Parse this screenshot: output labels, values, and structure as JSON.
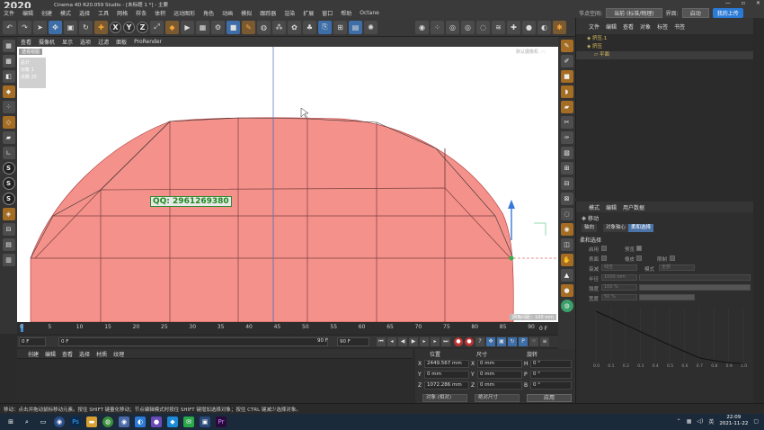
{
  "window": {
    "title": "Cinema 4D R20.059 Studio - [未标题 1 *] - 主要",
    "watermark": "2020",
    "controls": [
      "—",
      "▫",
      "✕"
    ]
  },
  "menubar": [
    "文件",
    "编辑",
    "创建",
    "模式",
    "选择",
    "工具",
    "网格",
    "样条",
    "体积",
    "运动图形",
    "角色",
    "动画",
    "模拟",
    "跟踪器",
    "渲染",
    "扩展",
    "窗口",
    "帮助",
    "Octane"
  ],
  "layout": {
    "label": "节点空间:",
    "value": "当前 (标准/物理)",
    "interface_label": "界面:",
    "interface_value": "启动",
    "login_label": "我的上传"
  },
  "viewport": {
    "menu": [
      "查看",
      "摄像机",
      "显示",
      "选项",
      "过滤",
      "面板",
      "ProRender"
    ],
    "name_label": "透视视图",
    "camera_label": "默认摄像机 ∴∵",
    "hud": {
      "line1": "总计",
      "line2": "对象  1",
      "line3": "点数  25"
    },
    "grid_info": "网格间距：100 mm",
    "qq_prefix": "QQ:",
    "qq_number": "2961269380",
    "shape_color": "#f4918a"
  },
  "timeline": {
    "ticks": [
      "0",
      "5",
      "10",
      "15",
      "20",
      "25",
      "30",
      "35",
      "40",
      "45",
      "50",
      "55",
      "60",
      "65",
      "70",
      "75",
      "80",
      "85",
      "90"
    ],
    "current_frame": "0 F",
    "start_frame": "0 F",
    "end_frame": "90 F",
    "end_frame2": "90 F",
    "frame_right": "0 F"
  },
  "material_menu": [
    "创建",
    "编辑",
    "查看",
    "选择",
    "材质",
    "纹理"
  ],
  "coordinates": {
    "headers": [
      "位置",
      "尺寸",
      "旋转"
    ],
    "rows": [
      {
        "axis": "X",
        "pos": "2449.567 mm",
        "size_axis": "X",
        "size": "0 mm",
        "rot_axis": "H",
        "rot": "0 °"
      },
      {
        "axis": "Y",
        "pos": "0 mm",
        "size_axis": "Y",
        "size": "0 mm",
        "rot_axis": "P",
        "rot": "0 °"
      },
      {
        "axis": "Z",
        "pos": "1072.286 mm",
        "size_axis": "Z",
        "size": "0 mm",
        "rot_axis": "B",
        "rot": "0 °"
      }
    ],
    "mode": "对象 (相对)",
    "size_mode": "绝对尺寸",
    "apply": "应用"
  },
  "objects": {
    "menu": [
      "文件",
      "编辑",
      "查看",
      "对象",
      "标签",
      "书签"
    ],
    "items": [
      {
        "name": "挤压.1",
        "indent": 0
      },
      {
        "name": "挤压",
        "indent": 0
      },
      {
        "name": "平面",
        "indent": 1
      }
    ]
  },
  "attributes": {
    "menu": [
      "模式",
      "编辑",
      "用户数据"
    ],
    "tool": "移动",
    "tabs": [
      "轴向",
      "对象轴心",
      "柔和选择"
    ],
    "active_tab": "柔和选择",
    "section": "柔和选择",
    "fields": {
      "enable": "启用",
      "preview": "预览",
      "surface": "表面",
      "rubber": "橡皮",
      "restrict": "限制",
      "mode_label": "衰减",
      "mode_value": "线性",
      "mode2_label": "模式",
      "mode2_value": "全部",
      "radius_label": "半径",
      "radius_value": "1000 mm",
      "strength_label": "强度",
      "strength_value": "100 %",
      "width_label": "宽度",
      "width_value": "50 %"
    },
    "curve_axis": [
      "0.0",
      "0.1",
      "0.2",
      "0.3",
      "0.4",
      "0.5",
      "0.6",
      "0.7",
      "0.8",
      "0.9",
      "1.0"
    ]
  },
  "status": "移动：点击并拖动鼠标移动元素。按住 SHIFT 键量化移动；节点编辑模式时按住 SHIFT 键增加选择对象；按住 CTRL 键减少选择对象。",
  "taskbar": {
    "time": "22:09",
    "date": "2021-11-22"
  }
}
